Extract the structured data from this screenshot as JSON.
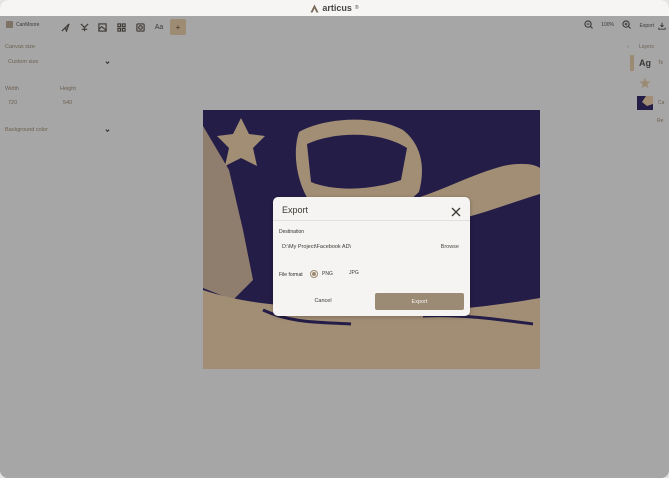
{
  "app": {
    "name": "articus",
    "mark": "®"
  },
  "toolbar": {
    "brand_label": "CanMoore",
    "zoom_value": "100%",
    "export_label": "Export"
  },
  "left_panel": {
    "canvas_size_label": "Canvas size",
    "canvas_size_value": "Custom size",
    "width_label": "Width",
    "height_label": "Height",
    "width_value": "720",
    "height_value": "540",
    "background_color_label": "Background color"
  },
  "right_panel": {
    "layers_label": "Layers",
    "text_layer_glyph": "Ag",
    "layer_names": [
      "Te",
      "",
      "Ca"
    ],
    "add_label": "Re"
  },
  "export_dialog": {
    "title": "Export",
    "destination_label": "Destination",
    "destination_path": "D:\\My Project\\Facebook AD\\",
    "browse_label": "Browse",
    "file_format_label": "File format",
    "formats": [
      "PNG",
      "JPG"
    ],
    "selected_format": "PNG",
    "cancel_label": "Cancel",
    "export_label": "Export"
  },
  "colors": {
    "accent": "#9b8b74",
    "canvas_dark": "#241d47",
    "canvas_tan": "#a28e75",
    "workspace": "#a7a6a6"
  }
}
